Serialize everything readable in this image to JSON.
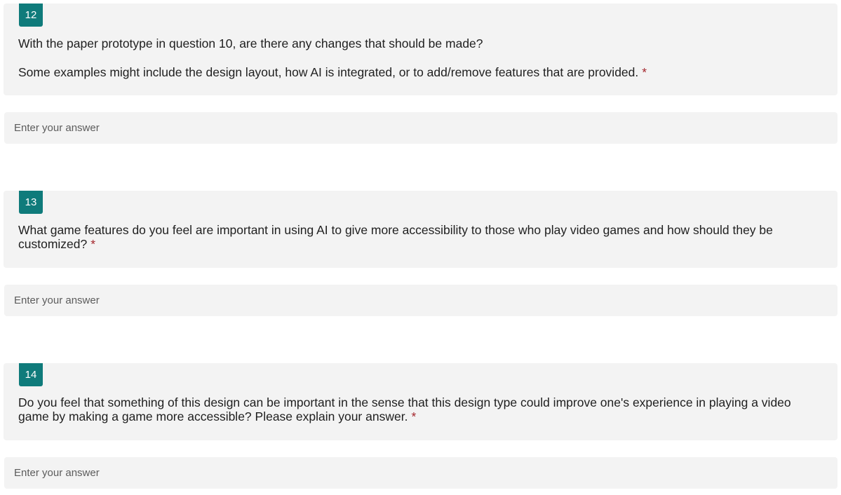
{
  "questions": [
    {
      "number": "12",
      "text": "With the paper prototype in question 10, are there any changes that should be made?",
      "subtext": "Some examples might include the design layout, how AI is integrated, or to add/remove features that are provided.",
      "required_mark": "*",
      "answer_placeholder": "Enter your answer",
      "answer_value": ""
    },
    {
      "number": "13",
      "text": "What game features do you feel are important in using AI to give more accessibility to those who play video games and how should they be customized?",
      "required_mark": "*",
      "answer_placeholder": "Enter your answer",
      "answer_value": ""
    },
    {
      "number": "14",
      "text": "Do you feel that something of this design can be important in the sense that this design type could improve one's experience in playing a video game by making a game more accessible? Please explain your answer.",
      "required_mark": "*",
      "answer_placeholder": "Enter your answer",
      "answer_value": ""
    }
  ],
  "colors": {
    "badge": "#0f7b7b",
    "card_background": "#f3f3f3",
    "required": "#a4262c"
  }
}
